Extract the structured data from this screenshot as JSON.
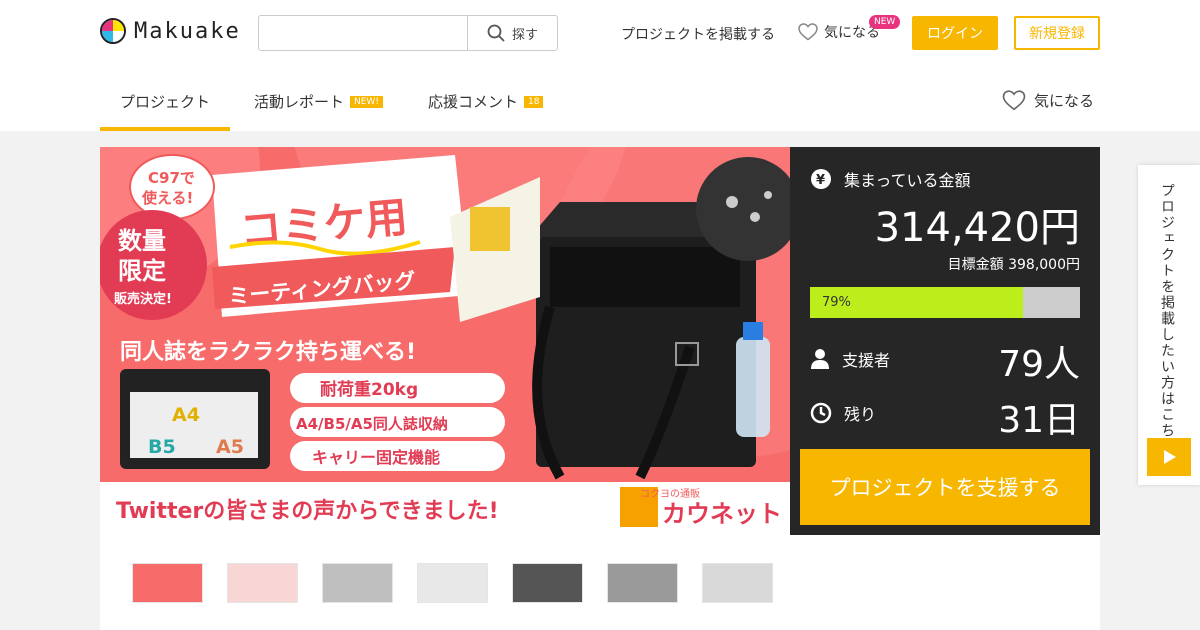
{
  "brand": {
    "name": "Makuake"
  },
  "search": {
    "placeholder": "",
    "button_label": "探す"
  },
  "top_nav": {
    "post_project": "プロジェクトを掲載する",
    "favorites": "気になる",
    "new_badge": "NEW",
    "login": "ログイン",
    "signup": "新規登録"
  },
  "tabs": [
    {
      "label": "プロジェクト",
      "active": true
    },
    {
      "label": "活動レポート",
      "badge": "NEW!"
    },
    {
      "label": "応援コメント",
      "badge": "18"
    }
  ],
  "favorite_tab": "気になる",
  "hero": {
    "ribbon_line1": "C97で",
    "ribbon_line2": "使える!",
    "circle_line1": "数量",
    "circle_line2": "限定",
    "circle_line3": "販売決定!",
    "title_main": "コミケ用",
    "title_sub": "ミーティングバッグ",
    "tagline": "同人誌をラクラク持ち運べる!",
    "feature1": "耐荷重20kg",
    "feature2": "A4/B5/A5同人誌収納",
    "feature3": "キャリー固定機能",
    "size_a4": "A4",
    "size_b5": "B5",
    "size_a5": "A5",
    "bottom_text": "Twitterの皆さまの声からできました!",
    "shop_sub": "コクヨの通販",
    "shop_name": "カウネット"
  },
  "funding": {
    "collected_label": "集まっている金額",
    "amount": "314,420円",
    "goal": "目標金額 398,000円",
    "progress_text": "79%",
    "progress": 0.79,
    "supporters_label": "支援者",
    "supporters": "79人",
    "remaining_label": "残り",
    "remaining": "31日",
    "support_button": "プロジェクトを支援する"
  },
  "side_tab": {
    "text": "プロジェクトを掲載したい方はこちら"
  },
  "colors": {
    "accent": "#f7b600",
    "progress": "#bbee1a",
    "panel": "#262626",
    "pink": "#e8337f",
    "hero": "#f76b6b"
  }
}
